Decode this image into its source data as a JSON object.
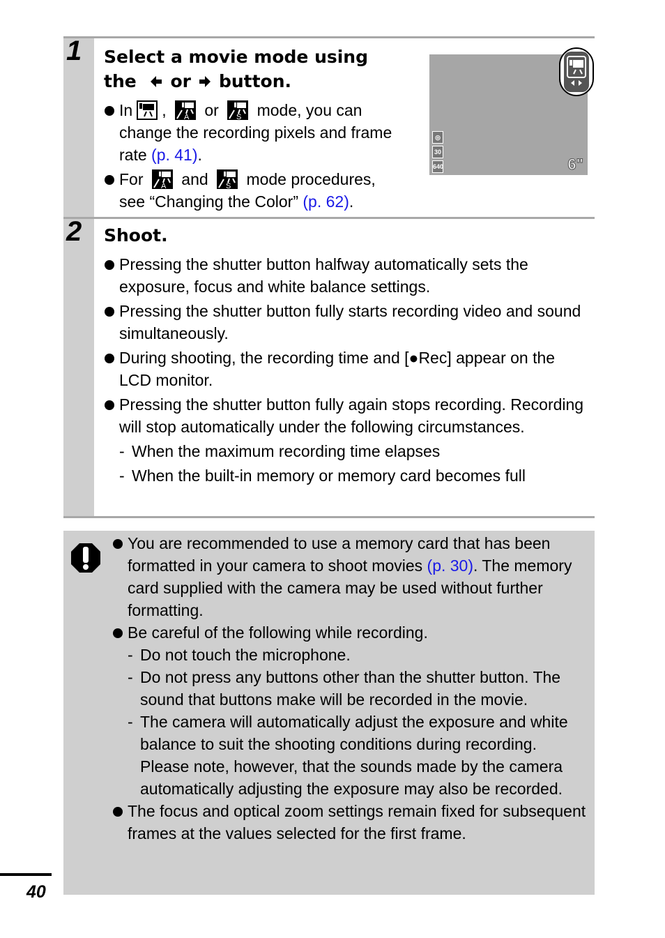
{
  "step1": {
    "number": "1",
    "title_line1": "Select a movie mode using",
    "title_the": "the",
    "title_or": "or",
    "title_button": "button.",
    "left_arrow_icon": "left-arrow-icon",
    "right_arrow_icon": "right-arrow-icon",
    "bullets": [
      {
        "pre": "In",
        "sep1": ",",
        "sep2": "or",
        "post": "mode, you can change the recording pixels and frame rate",
        "link": "(p. 41)",
        "end": ".",
        "icons": [
          "standard-movie-mode-icon",
          "color-accent-movie-icon",
          "color-swap-movie-icon"
        ]
      },
      {
        "pre": "For",
        "sep": "and",
        "post": "mode procedures, see “Changing the Color”",
        "link": "(p. 62)",
        "end": ".",
        "icons": [
          "color-accent-movie-icon",
          "color-swap-movie-icon"
        ]
      }
    ],
    "lcd": {
      "indicators": [
        "metering-icon",
        "30",
        "640"
      ],
      "time_remaining": "6\"",
      "mode_icon": "movie-mode-icon",
      "mode_hint_icon": "left-right-arrows-icon"
    }
  },
  "step2": {
    "number": "2",
    "title": "Shoot.",
    "bullets": [
      {
        "text": "Pressing the shutter button halfway automatically sets the exposure, focus and white balance settings."
      },
      {
        "text": "Pressing the shutter button fully starts recording video and sound simultaneously."
      },
      {
        "text_pre": "During shooting, the recording time and [",
        "rec_symbol": "●",
        "text_post": "Rec] appear on the LCD monitor."
      },
      {
        "text": "Pressing the shutter button fully again stops recording. Recording will stop automatically under the following circumstances."
      }
    ],
    "sub_items": [
      "When the maximum recording time elapses",
      "When the built-in memory or memory card becomes full"
    ]
  },
  "caution": {
    "icon": "caution-icon",
    "bullet1_text": "You are recommended to use a memory card that has been formatted in your camera to shoot movies",
    "bullet1_link": "(p. 30)",
    "bullet1_end": ". The memory card supplied with the camera may be used without further formatting.",
    "bullet2_text": "Be careful of the following while recording.",
    "bullet2_subs": [
      "Do not touch the microphone.",
      "Do not press any buttons other than the shutter button. The sound that buttons make will be recorded in the movie.",
      "The camera will automatically adjust the exposure and white balance to suit the shooting conditions during recording. Please note, however, that the sounds made by the camera automatically adjusting the exposure may also be recorded."
    ],
    "bullet3_text": "The focus and optical zoom settings remain fixed for subsequent frames at the values selected for the first frame."
  },
  "footer": {
    "page_number": "40"
  },
  "colors": {
    "link": "#1a1ae6",
    "gutter": "#cfcfcf",
    "rule": "#a8a8a8",
    "lcd": "#a6a6a6"
  }
}
